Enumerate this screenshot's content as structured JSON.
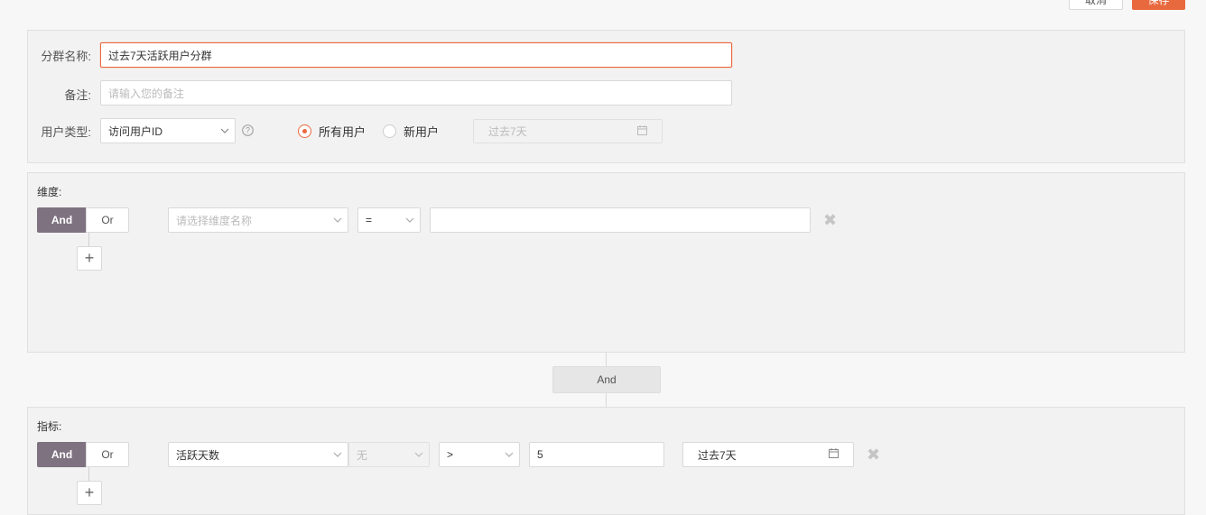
{
  "header": {
    "cancel_label": "取消",
    "save_label": "保存"
  },
  "group_form": {
    "name_label": "分群名称:",
    "name_value": "过去7天活跃用户分群",
    "remark_label": "备注:",
    "remark_placeholder": "请输入您的备注",
    "user_type_label": "用户类型:",
    "user_type_value": "访问用户ID",
    "help_icon": "question-circle-icon",
    "radio_all_label": "所有用户",
    "radio_new_label": "新用户",
    "radio_selected": "所有用户",
    "date_range_value": "过去7天",
    "calendar_icon": "calendar-icon"
  },
  "dimension_section": {
    "title": "维度:",
    "toggle_and": "And",
    "toggle_or": "Or",
    "toggle_selected": "And",
    "dimension_placeholder": "请选择维度名称",
    "operator_value": "=",
    "value_input": "",
    "remove_icon": "close-icon",
    "add_icon": "plus-icon"
  },
  "connector": {
    "label": "And"
  },
  "metric_section": {
    "title": "指标:",
    "toggle_and": "And",
    "toggle_or": "Or",
    "toggle_selected": "And",
    "metric_value": "活跃天数",
    "aggregation_value": "无",
    "operator_value": ">",
    "threshold_value": "5",
    "date_range_value": "过去7天",
    "calendar_icon": "calendar-icon",
    "remove_icon": "close-icon",
    "add_icon": "plus-icon"
  },
  "colors": {
    "accent": "#e9693e",
    "toggle_active": "#7e7280",
    "panel_bg": "#f2f2f2"
  }
}
